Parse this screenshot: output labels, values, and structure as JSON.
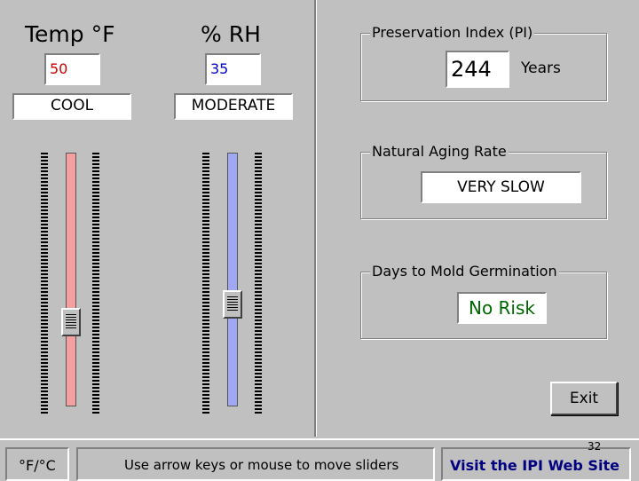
{
  "temperature": {
    "header": "Temp °F",
    "value": "50",
    "category": "COOL",
    "slider_level": 0.69,
    "value_color": "#cc0000",
    "track_color": "#f4a0a0"
  },
  "humidity": {
    "header": "% RH",
    "value": "35",
    "category": "MODERATE",
    "slider_level": 0.61,
    "value_color": "#0000cc",
    "track_color": "#a0a8f4"
  },
  "preservation_index": {
    "label": "Preservation Index (PI)",
    "value": "244",
    "unit": "Years"
  },
  "natural_aging_rate": {
    "label": "Natural Aging Rate",
    "value": "VERY SLOW"
  },
  "mold_germination": {
    "label": "Days to Mold Germination",
    "value": "No Risk",
    "value_color": "#006600"
  },
  "exit_button": {
    "label": "Exit"
  },
  "status_bar": {
    "unit_toggle": "°F/°C",
    "hint": "Use arrow keys or mouse to move sliders",
    "link": "Visit the IPI Web Site",
    "link_color": "#000080",
    "page_number": "32"
  }
}
